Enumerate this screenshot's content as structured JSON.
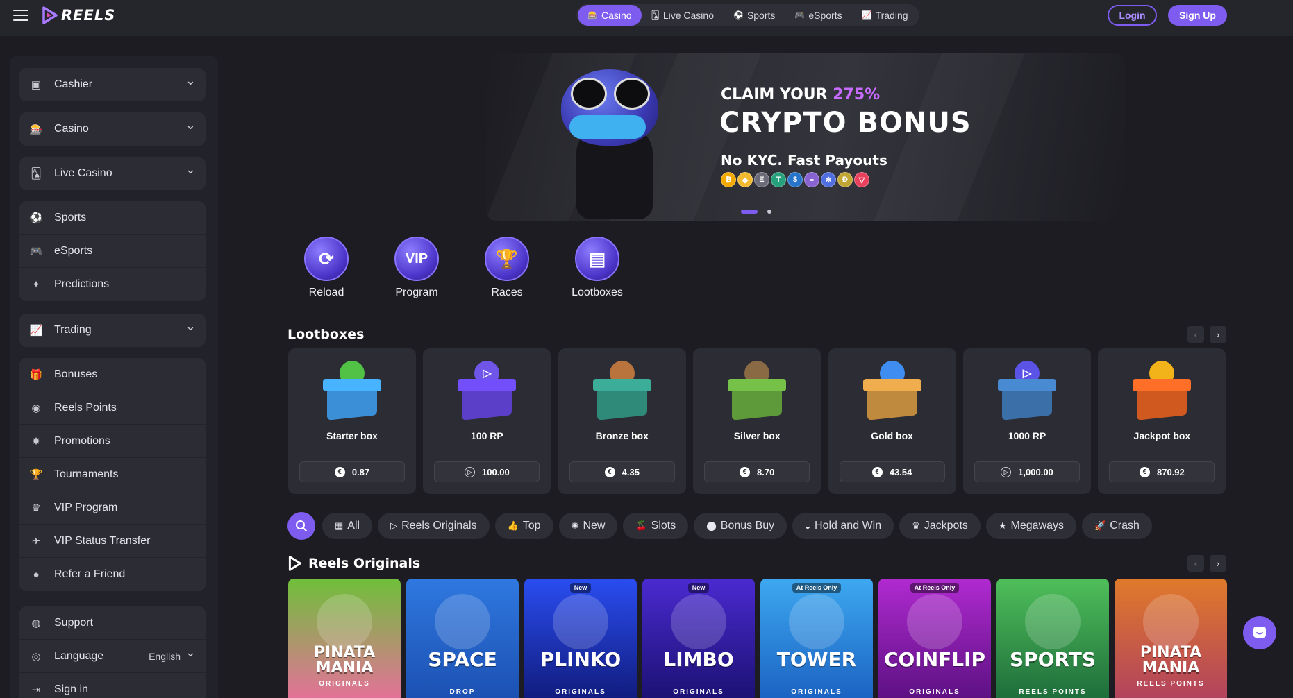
{
  "header": {
    "logo": "REELS",
    "nav": [
      {
        "label": "Casino",
        "icon": "casino-icon",
        "active": true
      },
      {
        "label": "Live Casino",
        "icon": "live-casino-icon",
        "active": false
      },
      {
        "label": "Sports",
        "icon": "sports-icon",
        "active": false
      },
      {
        "label": "eSports",
        "icon": "esports-icon",
        "active": false
      },
      {
        "label": "Trading",
        "icon": "trading-icon",
        "active": false
      }
    ],
    "login": "Login",
    "signup": "Sign Up"
  },
  "sidebar": {
    "g1": [
      {
        "label": "Cashier",
        "icon": "cashier-icon"
      }
    ],
    "g2": [
      {
        "label": "Casino",
        "icon": "casino-icon"
      }
    ],
    "g3": [
      {
        "label": "Live Casino",
        "icon": "live-casino-icon"
      }
    ],
    "g4": [
      {
        "label": "Sports",
        "icon": "sports-icon"
      },
      {
        "label": "eSports",
        "icon": "esports-icon"
      },
      {
        "label": "Predictions",
        "icon": "predictions-icon"
      }
    ],
    "g5": [
      {
        "label": "Trading",
        "icon": "trading-icon"
      }
    ],
    "g6": [
      {
        "label": "Bonuses",
        "icon": "gift-icon"
      },
      {
        "label": "Reels Points",
        "icon": "reels-points-icon"
      },
      {
        "label": "Promotions",
        "icon": "promotions-icon"
      },
      {
        "label": "Tournaments",
        "icon": "trophy-icon"
      },
      {
        "label": "VIP Program",
        "icon": "crown-icon"
      },
      {
        "label": "VIP Status Transfer",
        "icon": "plane-icon"
      },
      {
        "label": "Refer a Friend",
        "icon": "user-icon"
      }
    ],
    "g7": [
      {
        "label": "Support",
        "icon": "support-icon"
      },
      {
        "label": "Language",
        "icon": "globe-icon",
        "value": "English"
      },
      {
        "label": "Sign in",
        "icon": "sign-in-icon"
      }
    ]
  },
  "hero": {
    "claim_prefix": "CLAIM YOUR ",
    "claim_pct": "275%",
    "title": "CRYPTO BONUS",
    "subtitle": "No KYC. Fast Payouts",
    "coins": [
      "₿",
      "◆",
      "Ξ",
      "T",
      "$",
      "≡",
      "✻",
      "Ð",
      "▽"
    ],
    "coin_colors": [
      "#f2a900",
      "#f3ba2f",
      "#6b6b7a",
      "#26a17b",
      "#2775ca",
      "#8a63d2",
      "#4f6ee0",
      "#c2a633",
      "#e8415e"
    ],
    "slides": 2,
    "active_slide": 0
  },
  "quick_links": [
    {
      "label": "Reload",
      "icon": "reload-icon"
    },
    {
      "label": "Program",
      "icon": "vip-icon"
    },
    {
      "label": "Races",
      "icon": "trophy-icon"
    },
    {
      "label": "Lootboxes",
      "icon": "lootbox-icon"
    }
  ],
  "lootboxes": {
    "title": "Lootboxes",
    "items": [
      {
        "name": "Starter box",
        "price": "0.87",
        "currency": "eur",
        "color": "#3a8fd6",
        "accent": "#52c247"
      },
      {
        "name": "100 RP",
        "price": "100.00",
        "currency": "rp",
        "color": "#5b3fc9",
        "accent": "#6f55e8"
      },
      {
        "name": "Bronze box",
        "price": "4.35",
        "currency": "eur",
        "color": "#2f8a7a",
        "accent": "#b8743c"
      },
      {
        "name": "Silver box",
        "price": "8.70",
        "currency": "eur",
        "color": "#5e9a3a",
        "accent": "#8a6a44"
      },
      {
        "name": "Gold box",
        "price": "43.54",
        "currency": "eur",
        "color": "#c08a3e",
        "accent": "#3f8df0"
      },
      {
        "name": "1000 RP",
        "price": "1,000.00",
        "currency": "rp",
        "color": "#3a6fa8",
        "accent": "#5b52e6"
      },
      {
        "name": "Jackpot box",
        "price": "870.92",
        "currency": "eur",
        "color": "#d0591f",
        "accent": "#f2b31a"
      }
    ]
  },
  "filters": [
    {
      "label": "All",
      "icon": "grid-icon"
    },
    {
      "label": "Reels Originals",
      "icon": "reels-logo-icon"
    },
    {
      "label": "Top",
      "icon": "thumbs-up-icon"
    },
    {
      "label": "New",
      "icon": "badge-icon"
    },
    {
      "label": "Slots",
      "icon": "cherries-icon"
    },
    {
      "label": "Bonus Buy",
      "icon": "coin-icon"
    },
    {
      "label": "Hold and Win",
      "icon": "coins-icon"
    },
    {
      "label": "Jackpots",
      "icon": "crown-icon"
    },
    {
      "label": "Megaways",
      "icon": "star-icon"
    },
    {
      "label": "Crash",
      "icon": "rocket-icon"
    }
  ],
  "originals": {
    "title": "Reels Originals",
    "games": [
      {
        "title": "PINATA MANIA",
        "sub": "ORIGINALS",
        "badge": "",
        "bg1": "#6fbf3a",
        "bg2": "#e86f9c"
      },
      {
        "title": "SPACE",
        "sub": "DROP",
        "badge": "",
        "bg1": "#2f78e0",
        "bg2": "#1b4fb0"
      },
      {
        "title": "PLINKO",
        "sub": "ORIGINALS",
        "badge": "New",
        "bg1": "#2a4df0",
        "bg2": "#101a7a"
      },
      {
        "title": "LIMBO",
        "sub": "ORIGINALS",
        "badge": "New",
        "bg1": "#4a2ad0",
        "bg2": "#1a1070"
      },
      {
        "title": "TOWER",
        "sub": "ORIGINALS",
        "badge": "At Reels Only",
        "bg1": "#3da8f0",
        "bg2": "#1a60c0"
      },
      {
        "title": "COINFLIP",
        "sub": "ORIGINALS",
        "badge": "At Reels Only",
        "bg1": "#b02ad0",
        "bg2": "#5a1080"
      },
      {
        "title": "SPORTS",
        "sub": "REELS POINTS",
        "badge": "",
        "bg1": "#4fbf5a",
        "bg2": "#1c6a3a"
      },
      {
        "title": "PINATA MANIA",
        "sub": "REELS POINTS",
        "badge": "",
        "bg1": "#e07a2a",
        "bg2": "#b04060"
      }
    ]
  }
}
